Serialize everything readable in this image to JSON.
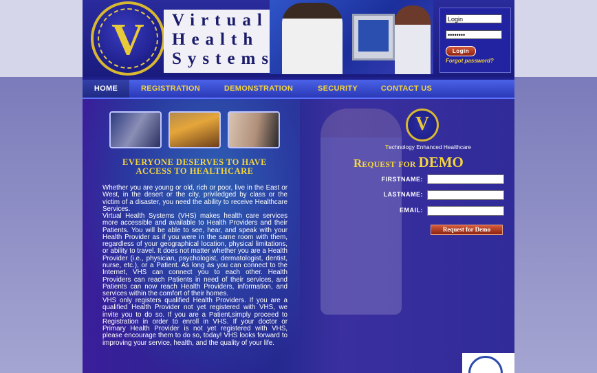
{
  "header": {
    "logo_letter": "V",
    "brand_lines": [
      "Virtual",
      "Health",
      "Systems"
    ]
  },
  "login": {
    "username_value": "Login",
    "password_value": "••••••••",
    "button_label": "Login",
    "forgot_label": "Forgot password?"
  },
  "nav": {
    "items": [
      {
        "label": "HOME",
        "active": true
      },
      {
        "label": "REGISTRATION",
        "active": false
      },
      {
        "label": "DEMONSTRATION",
        "active": false
      },
      {
        "label": "SECURITY",
        "active": false
      },
      {
        "label": "CONTACT US",
        "active": false
      }
    ]
  },
  "main": {
    "tagline": "Everyone deserves to have access to healthcare",
    "paragraphs": [
      "Whether you are young or old, rich or poor, live in the East or West, in the desert or the city, priviledged by class or the victim of a disaster, you need the ability to receive Healthcare Services.",
      "Virtual Health Systems (VHS) makes health care services more accessible and available to Health Providers and their Patients. You will be able to see, hear, and speak with your Health Provider as if you were in the same room with them, regardless of your geographical location, physical limitations, or ability to travel. It does not matter whether you are a Health Provider (i.e., physician, psychologist, dermatologist, dentist, nurse, etc.), or a Patient. As long as you can connect to the Internet, VHS can connect you to each other. Health Providers can reach Patients in need of their services, and Patients can now reach Health Providers, information, and services within the comfort of their homes.",
      "VHS only registers qualified Health Providers. If you are a qualified Health Provider not yet registered with VHS, we invite you to do so. If you are a Patient,simply proceed to Registration in order to enroll in VHS. If your doctor or Primary Health Provider is not yet registered with VHS, please encourage them to do so, today! VHS looks forward to improving your service, health, and the quality of your life."
    ]
  },
  "demo": {
    "tech_line_prefix": "T",
    "tech_line": "echnology Enhanced Healthcare",
    "title_word1": "Request for",
    "title_word2": "DEMO",
    "firstname_label": "Firstname:",
    "lastname_label": "Lastname:",
    "email_label": "Email:",
    "button_label": "Request for Demo"
  },
  "colors": {
    "accent_yellow": "#f3d43e",
    "page_blue": "#1e1f8a",
    "button_red": "#8c2310"
  }
}
